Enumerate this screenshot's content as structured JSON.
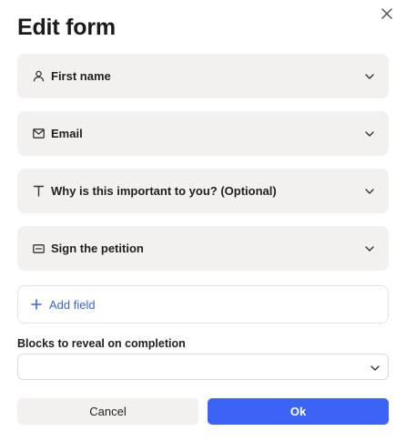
{
  "dialog": {
    "title": "Edit form",
    "close_icon": "close-icon"
  },
  "fields": [
    {
      "label": "First name",
      "icon": "person-icon"
    },
    {
      "label": "Email",
      "icon": "envelope-icon"
    },
    {
      "label": "Why is this important to you? (Optional)",
      "icon": "text-icon"
    },
    {
      "label": "Sign the petition",
      "icon": "button-icon"
    }
  ],
  "add_field": {
    "label": "Add field",
    "icon": "plus-icon"
  },
  "reveal": {
    "label": "Blocks to reveal on completion",
    "value": ""
  },
  "footer": {
    "cancel_label": "Cancel",
    "ok_label": "Ok"
  },
  "colors": {
    "accent": "#3b63f6",
    "link": "#3565e6",
    "row_background": "#f2f1ef"
  }
}
